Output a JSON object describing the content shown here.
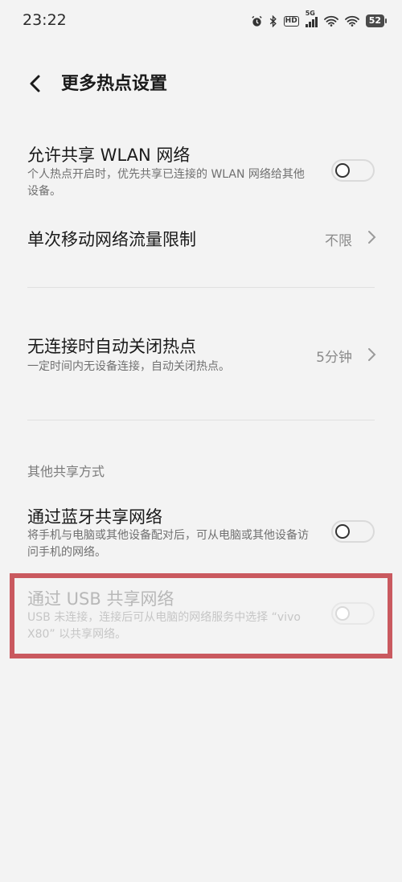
{
  "status_bar": {
    "time": "23:22",
    "network_tag": "5G",
    "hd_label": "HD",
    "battery": "52"
  },
  "header": {
    "title": "更多热点设置"
  },
  "settings": {
    "share_wlan": {
      "title": "允许共享 WLAN 网络",
      "desc": "个人热点开启时，优先共享已连接的 WLAN 网络给其他设备。",
      "enabled": false
    },
    "data_limit": {
      "title": "单次移动网络流量限制",
      "value": "不限"
    },
    "auto_close": {
      "title": "无连接时自动关闭热点",
      "desc": "一定时间内无设备连接，自动关闭热点。",
      "value": "5分钟"
    }
  },
  "other_sharing": {
    "section_label": "其他共享方式",
    "bluetooth": {
      "title": "通过蓝牙共享网络",
      "desc": "将手机与电脑或其他设备配对后，可从电脑或其他设备访问手机的网络。",
      "enabled": false
    },
    "usb": {
      "title": "通过 USB 共享网络",
      "desc": "USB 未连接，连接后可从电脑的网络服务中选择 “vivo X80” 以共享网络。",
      "enabled": false,
      "disabled": true
    }
  },
  "colors": {
    "background": "#f3f3f3",
    "highlight_border": "#c9595f"
  }
}
